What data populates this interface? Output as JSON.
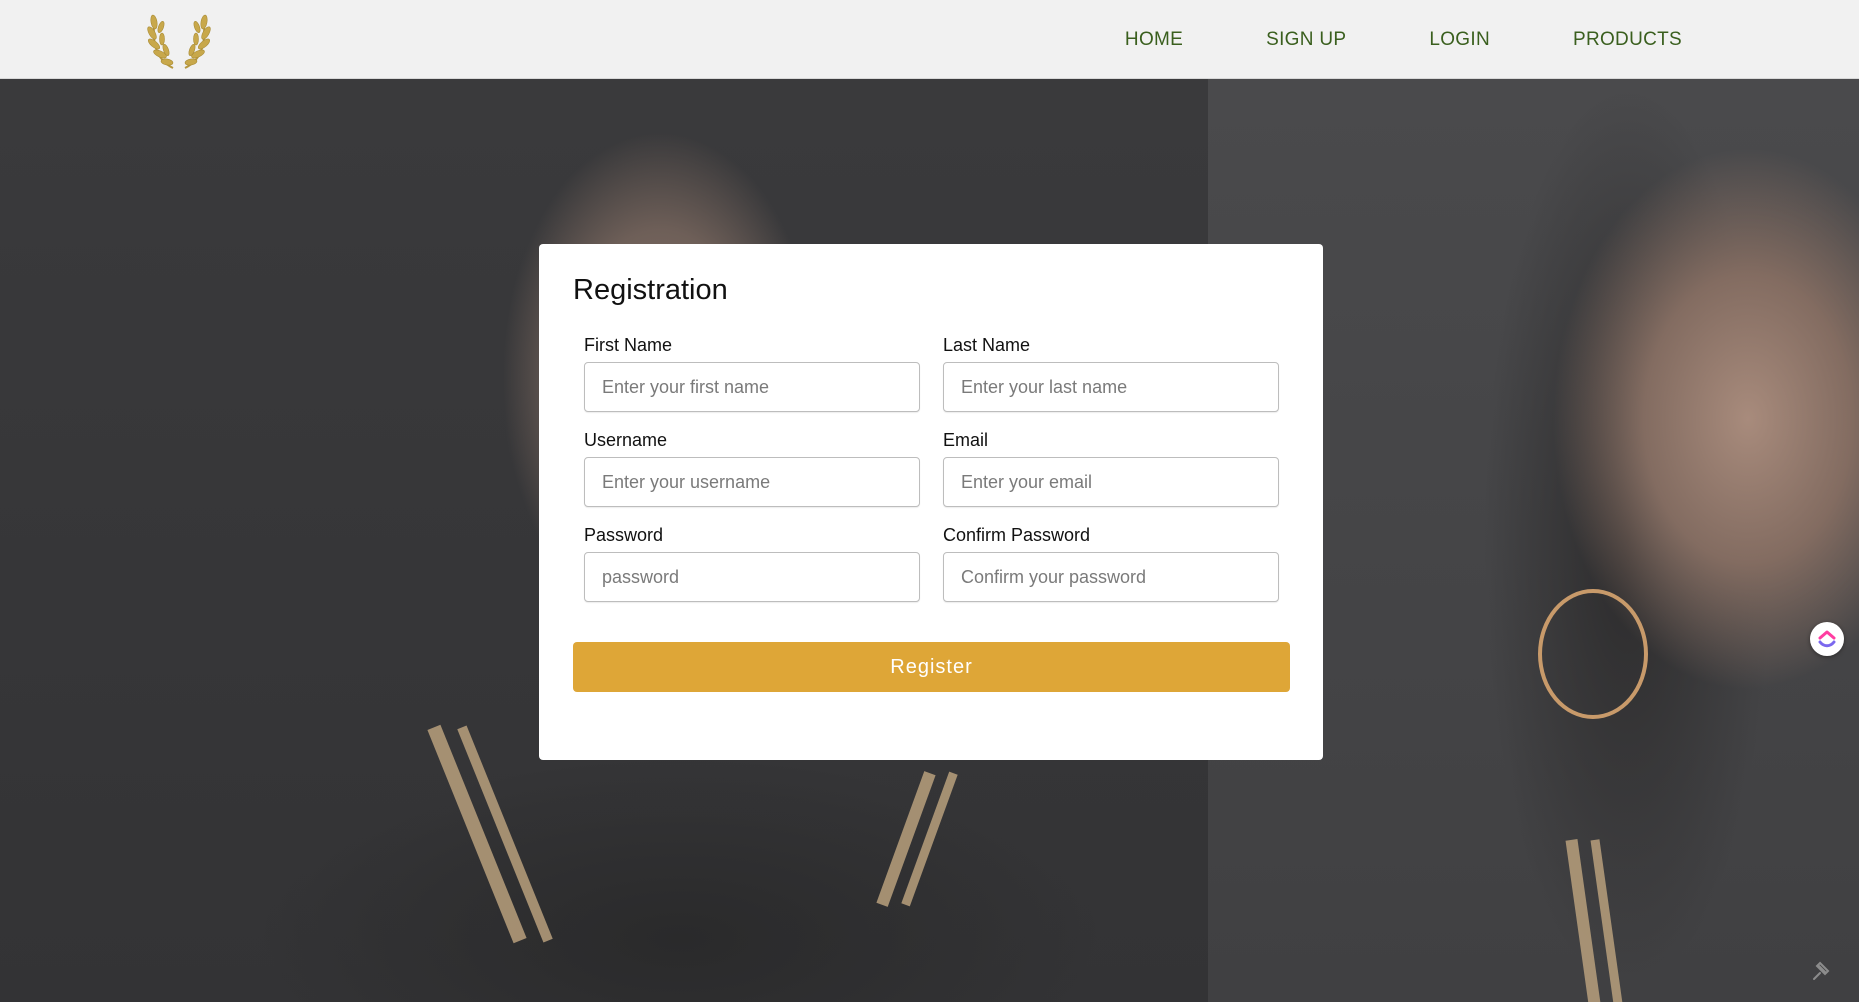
{
  "header": {
    "logo_icon": "laurel-wreath-icon",
    "logo_color": "#c8a84b",
    "nav": [
      {
        "label": "HOME"
      },
      {
        "label": "SIGN UP"
      },
      {
        "label": "LOGIN"
      },
      {
        "label": "PRODUCTS"
      }
    ],
    "nav_color": "#3a5f1e"
  },
  "form": {
    "title": "Registration",
    "fields": [
      {
        "label": "First Name",
        "placeholder": "Enter your first name",
        "value": ""
      },
      {
        "label": "Last Name",
        "placeholder": "Enter your last name",
        "value": ""
      },
      {
        "label": "Username",
        "placeholder": "Enter your username",
        "value": ""
      },
      {
        "label": "Email",
        "placeholder": "Enter your email",
        "value": ""
      },
      {
        "label": "Password",
        "placeholder": "password",
        "value": ""
      },
      {
        "label": "Confirm Password",
        "placeholder": "Confirm your password",
        "value": ""
      }
    ],
    "submit_label": "Register",
    "accent_color": "#dea637"
  },
  "widgets": {
    "floating_button_icon": "clickup-logo-icon",
    "corner_icon": "pin-icon"
  }
}
